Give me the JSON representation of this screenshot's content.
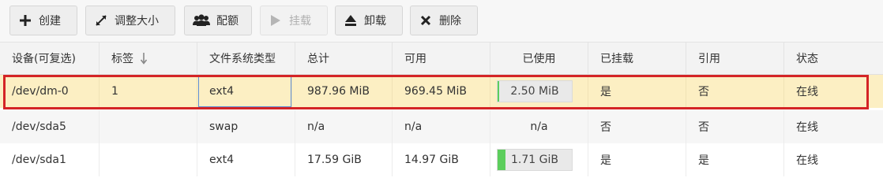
{
  "toolbar": {
    "create": "创建",
    "resize": "调整大小",
    "quota": "配额",
    "mount": "挂载",
    "unmount": "卸载",
    "delete": "删除"
  },
  "table": {
    "headers": {
      "device": "设备(可复选)",
      "label": "标签",
      "fs_type": "文件系统类型",
      "total": "总计",
      "available": "可用",
      "used": "已使用",
      "mounted": "已挂载",
      "referenced": "引用",
      "status": "状态"
    },
    "rows": [
      {
        "device": "/dev/dm-0",
        "label": "1",
        "fs_type": "ext4",
        "total": "987.96 MiB",
        "available": "969.45 MiB",
        "used": "2.50 MiB",
        "used_fraction": 0.003,
        "mounted": "是",
        "referenced": "否",
        "status": "在线"
      },
      {
        "device": "/dev/sda5",
        "label": "",
        "fs_type": "swap",
        "total": "n/a",
        "available": "n/a",
        "used": "n/a",
        "mounted": "否",
        "referenced": "否",
        "status": "在线"
      },
      {
        "device": "/dev/sda1",
        "label": "",
        "fs_type": "ext4",
        "total": "17.59 GiB",
        "available": "14.97 GiB",
        "used": "1.71 GiB",
        "used_fraction": 0.097,
        "mounted": "是",
        "referenced": "是",
        "status": "在线"
      }
    ]
  },
  "colors": {
    "selected_row": "#fcefc3",
    "usage_bar": "#5cce5c",
    "highlight_border": "#d42426"
  }
}
